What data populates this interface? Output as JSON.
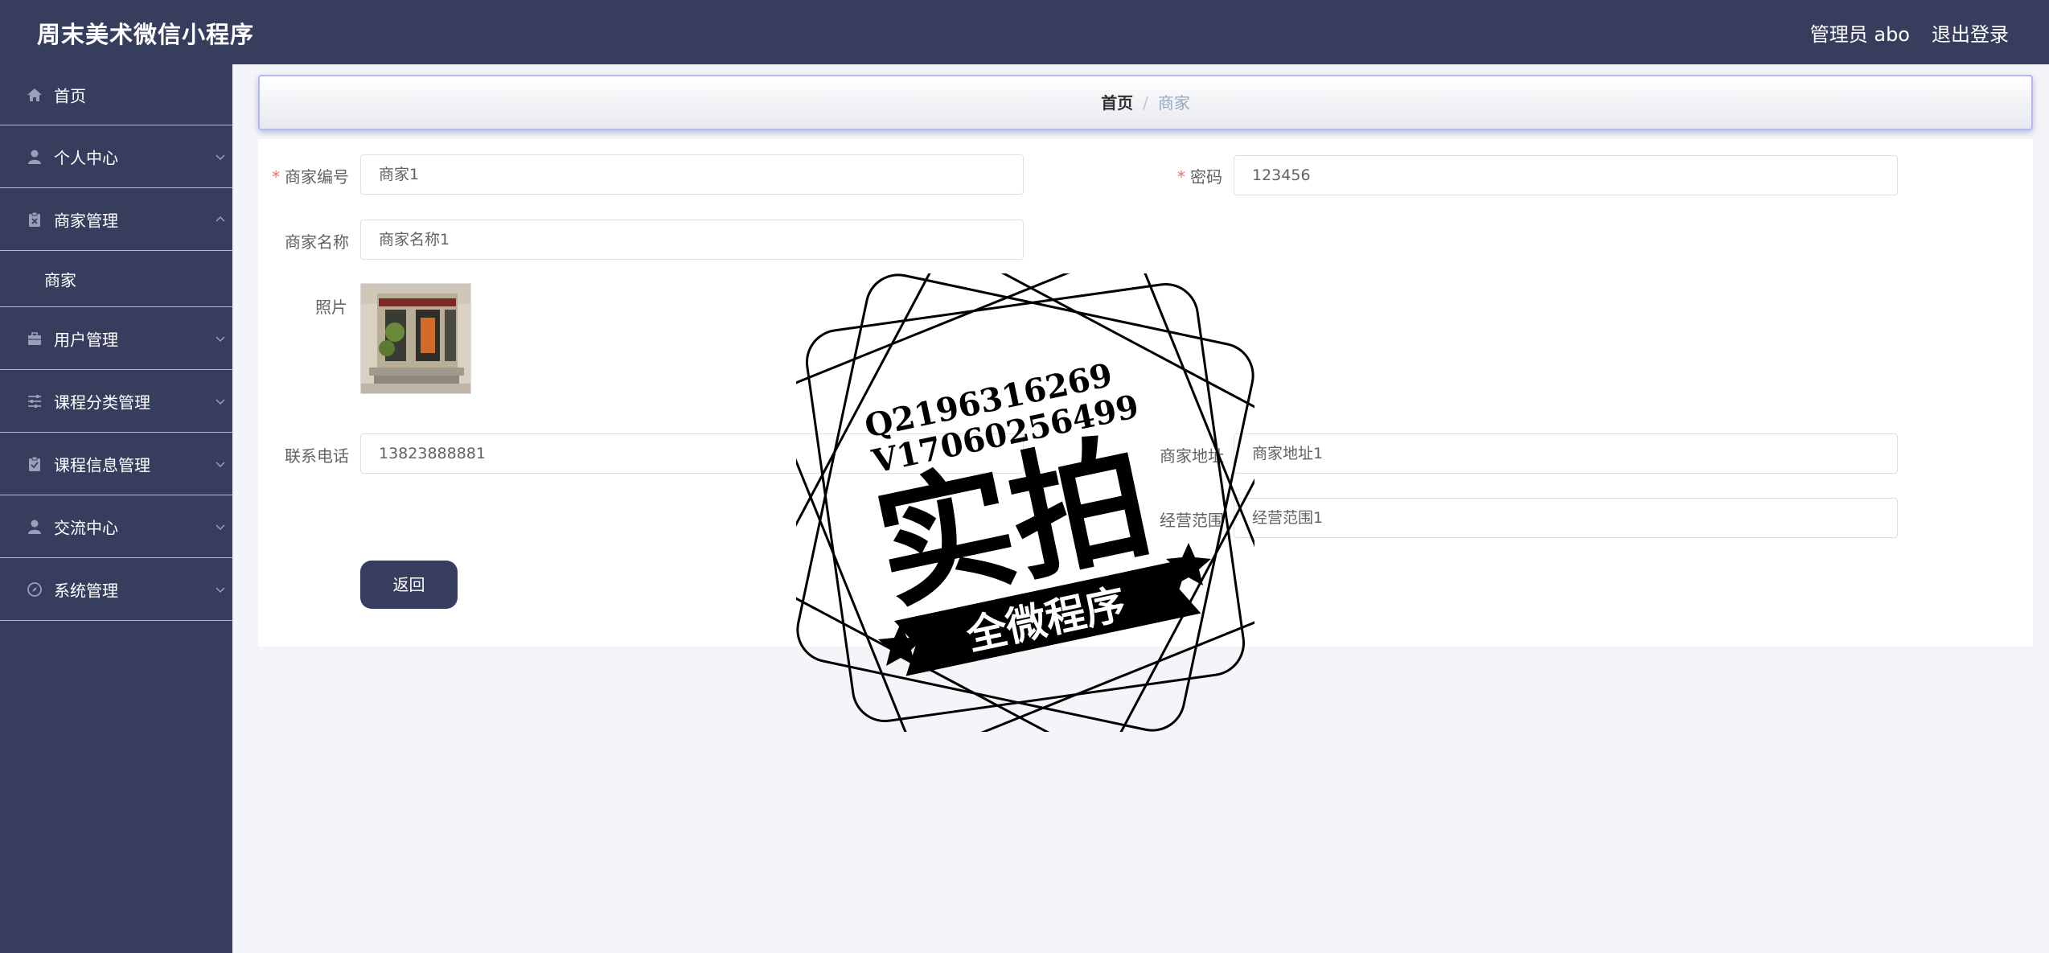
{
  "header": {
    "app_title": "周末美术微信小程序",
    "user": "管理员 abo",
    "logout": "退出登录"
  },
  "sidebar": {
    "items": [
      {
        "label": "首页",
        "icon": "home-icon"
      },
      {
        "label": "个人中心",
        "icon": "person-icon"
      },
      {
        "label": "商家管理",
        "icon": "clipboard-icon",
        "expanded": true
      },
      {
        "label": "用户管理",
        "icon": "briefcase-icon"
      },
      {
        "label": "课程分类管理",
        "icon": "sliders-icon"
      },
      {
        "label": "课程信息管理",
        "icon": "clipboard-check-icon"
      },
      {
        "label": "交流中心",
        "icon": "person-icon"
      },
      {
        "label": "系统管理",
        "icon": "compass-icon"
      }
    ],
    "submenu": [
      "商家"
    ]
  },
  "breadcrumb": {
    "home": "首页",
    "separator": "/",
    "current": "商家"
  },
  "form": {
    "merchant_no_label": "商家编号",
    "merchant_no_value": "商家1",
    "password_label": "密码",
    "password_value": "123456",
    "merchant_name_label": "商家名称",
    "merchant_name_value": "商家名称1",
    "photo_label": "照片",
    "phone_label": "联系电话",
    "phone_value": "13823888881",
    "address_label": "商家地址",
    "address_value": "商家地址1",
    "scope_label": "经营范围",
    "scope_value": "经营范围1",
    "back_button": "返回"
  },
  "watermark": {
    "line1": "Q2196316269",
    "line2": "V17060256499",
    "big": "实拍",
    "banner": "全微程序"
  },
  "colors": {
    "nav_bg": "#373d5d",
    "page_bg": "#f4f5f9",
    "required": "#f56c6c"
  }
}
